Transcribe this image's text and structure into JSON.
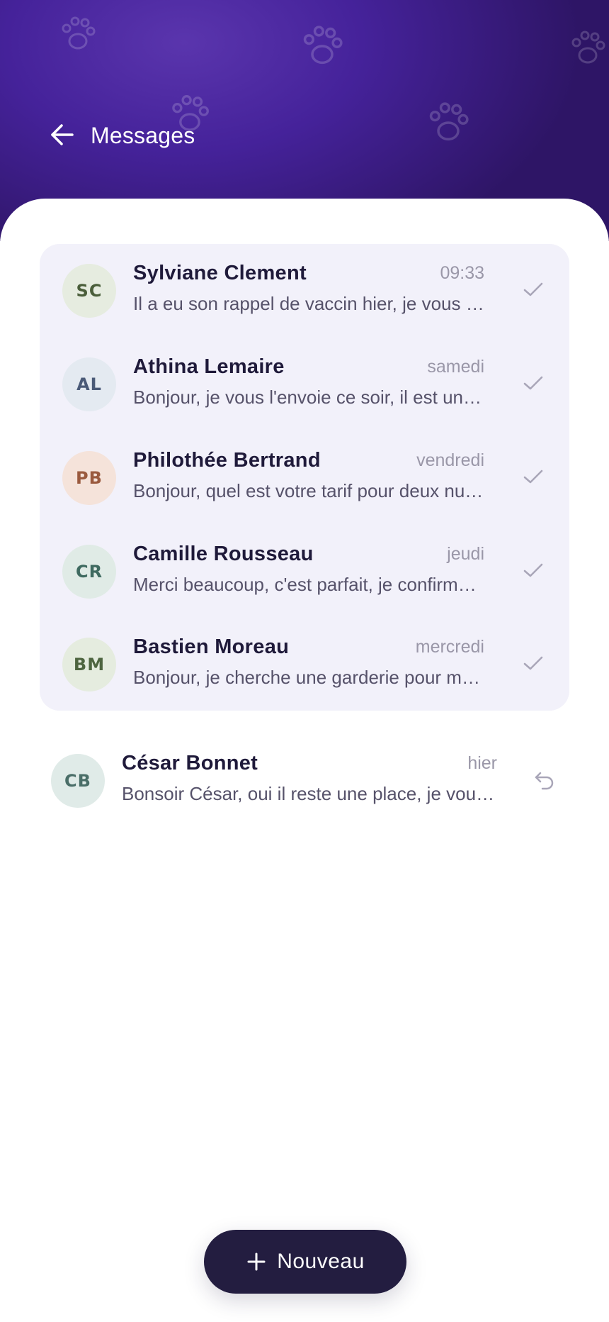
{
  "header": {
    "title": "Messages",
    "back_icon": "arrow-left-icon",
    "decoration_icon": "paw-icon"
  },
  "unread_conversations": [
    {
      "initials": "SC",
      "name": "Sylviane Clement",
      "time": "09:33",
      "preview": "Il a eu son rappel de vaccin hier, je vous envoie le carnet ce soir",
      "status_icon": "check-icon",
      "avatar_bg": "#e6ece0",
      "avatar_fg": "#4a5e3a"
    },
    {
      "initials": "AL",
      "name": "Athina Lemaire",
      "time": "samedi",
      "preview": "Bonjour, je vous l'envoie ce soir, il est un peu timide au début",
      "status_icon": "check-icon",
      "avatar_bg": "#e4eaf1",
      "avatar_fg": "#4a5a78"
    },
    {
      "initials": "PB",
      "name": "Philothée Bertrand",
      "time": "vendredi",
      "preview": "Bonjour, quel est votre tarif pour deux nuits le week-end prochain ?",
      "status_icon": "check-icon",
      "avatar_bg": "#f5e3da",
      "avatar_fg": "#9a5a3e"
    },
    {
      "initials": "CR",
      "name": "Camille Rousseau",
      "time": "jeudi",
      "preview": "Merci beaucoup, c'est parfait, je confirme pour la semaine prochaine",
      "status_icon": "check-icon",
      "avatar_bg": "#e0ebe6",
      "avatar_fg": "#3f6a60"
    },
    {
      "initials": "BM",
      "name": "Bastien Moreau",
      "time": "mercredi",
      "preview": "Bonjour, je cherche une garderie pour mon chien pendant les vacances",
      "status_icon": "check-icon",
      "avatar_bg": "#e5ecdf",
      "avatar_fg": "#4e6540"
    }
  ],
  "read_conversations": [
    {
      "initials": "CB",
      "name": "César Bonnet",
      "time": "hier",
      "preview": "Bonsoir César, oui il reste une place, je vous réserve la semaine",
      "status_icon": "reply-icon",
      "avatar_bg": "#e0ebe8",
      "avatar_fg": "#4a6e68"
    }
  ],
  "fab": {
    "label": "Nouveau",
    "icon": "plus-icon"
  },
  "colors": {
    "header_purple": "#45229a",
    "card_bg": "#f2f1fa",
    "fab_bg": "#231d40",
    "muted_text": "#9a97a8"
  }
}
